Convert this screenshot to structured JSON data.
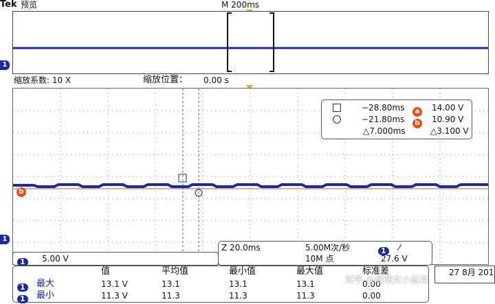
{
  "top": {
    "brand": "Tek",
    "mode": "预览",
    "timebase": "M 200ms"
  },
  "zoom": {
    "factor_label": "缩放系数: 10 X",
    "position_label": "缩放位置：",
    "position_value": "0.00 s"
  },
  "markers": {
    "ch1": "1",
    "ref_a": "a",
    "ref_b": "b"
  },
  "cursors": {
    "cursor1_time": "−28.80ms",
    "cursor1_value": "14.00 V",
    "cursor2_time": "−21.80ms",
    "cursor2_value": "10.90 V",
    "delta_time": "△7.000ms",
    "delta_value": "△3.100 V"
  },
  "channel": {
    "label": "1",
    "scale": "5.00 V"
  },
  "acquisition": {
    "zoom_time": "Z 20.0ms",
    "sample_rate": "5.00M次/秒",
    "record_length": "10M 点",
    "trigger_channel": "1",
    "trigger_slope": "⁄",
    "trigger_level": "27.6 V"
  },
  "measurements": {
    "headers": [
      "值",
      "平均值",
      "最小值",
      "最大值",
      "标准差"
    ],
    "rows": [
      {
        "channel": "1",
        "label": "最大",
        "value": "13.1 V",
        "mean": "13.1",
        "min": "13.1",
        "max": "13.1",
        "std": "0.00"
      },
      {
        "channel": "1",
        "label": "最小",
        "value": "11.3 V",
        "mean": "11.3",
        "min": "11.3",
        "max": "11.3",
        "std": "0.00"
      }
    ]
  },
  "date": "27 8月 201",
  "watermark": "知乎 @晨曦女小兹森",
  "colors": {
    "trace": "#1a2a9c",
    "accent": "#e0521a",
    "grid": "#777777",
    "background": "#ffffff"
  }
}
